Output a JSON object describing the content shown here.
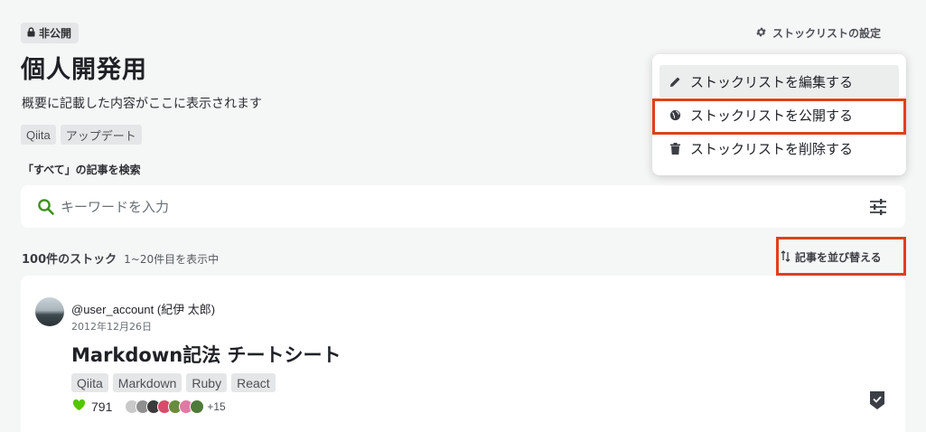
{
  "header": {
    "visibility_badge": "非公開",
    "title": "個人開発用",
    "description": "概要に記載した内容がここに表示されます",
    "tags": [
      "Qiita",
      "アップデート"
    ],
    "settings_label": "ストックリストの設定"
  },
  "search": {
    "label": "「すべて」の記事を検索",
    "placeholder": "キーワードを入力"
  },
  "menu": {
    "items": [
      {
        "label": "ストックリストを編集する",
        "icon": "pencil-icon"
      },
      {
        "label": "ストックリストを公開する",
        "icon": "globe-icon"
      },
      {
        "label": "ストックリストを削除する",
        "icon": "trash-icon"
      }
    ]
  },
  "stock_summary": {
    "count_label": "100件のストック",
    "range_label": "1~20件目を表示中",
    "sort_label": "記事を並び替える"
  },
  "article": {
    "author": "@user_account (紀伊 太郎)",
    "date": "2012年12月26日",
    "title": "Markdown記法 チートシート",
    "tags": [
      "Qiita",
      "Markdown",
      "Ruby",
      "React"
    ],
    "likes": "791",
    "more_stockers": "+15"
  },
  "colors": {
    "accent_green": "#55c500",
    "highlight_red": "#e0401c",
    "search_green": "#3f8f1f"
  }
}
